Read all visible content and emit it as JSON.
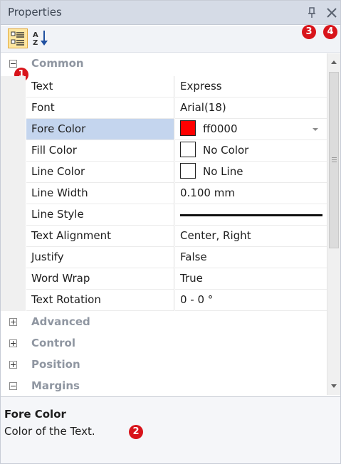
{
  "window": {
    "title": "Properties",
    "pin_icon": "pin-icon",
    "close_icon": "close-icon"
  },
  "toolbar": {
    "categorized_icon": "categorized-view-icon",
    "alphabetical_icon": "alphabetical-sort-icon"
  },
  "annotations": [
    "1",
    "2",
    "3",
    "4"
  ],
  "grid": {
    "category_common": "Common",
    "properties": [
      {
        "name": "Text",
        "value": "Express"
      },
      {
        "name": "Font",
        "value": "Arial(18)"
      },
      {
        "name": "Fore Color",
        "value": "ff0000",
        "swatch": "#ff0000"
      },
      {
        "name": "Fill Color",
        "value": "No Color",
        "swatch": "#ffffff"
      },
      {
        "name": "Line Color",
        "value": "No Line",
        "swatch": "#ffffff"
      },
      {
        "name": "Line Width",
        "value": "0.100 mm"
      },
      {
        "name": "Line Style",
        "value": ""
      },
      {
        "name": "Text Alignment",
        "value": "Center, Right"
      },
      {
        "name": "Justify",
        "value": "False"
      },
      {
        "name": "Word Wrap",
        "value": "True"
      },
      {
        "name": "Text Rotation",
        "value": "0 - 0 °"
      }
    ],
    "collapsed_categories": [
      "Advanced",
      "Control",
      "Position",
      "Margins"
    ]
  },
  "description": {
    "title": "Fore Color",
    "text": "Color of the Text."
  },
  "colors": {
    "accent_badge": "#d8141b",
    "selected_row": "#c4d5ee",
    "titlebar": "#d5dbe6"
  }
}
